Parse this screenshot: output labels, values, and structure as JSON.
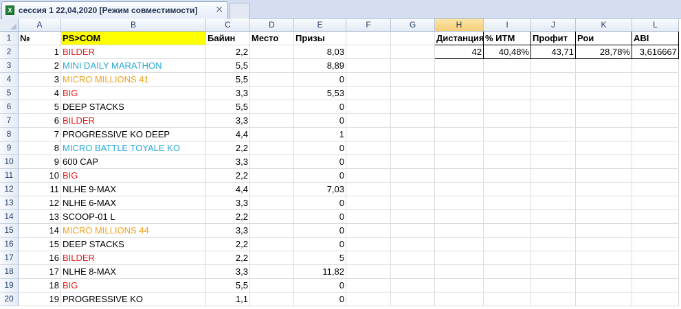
{
  "tab": {
    "icon": "excel-file-icon",
    "title": "сессия 1 22,04,2020  [Режим совместимости]",
    "close_glyph": "×"
  },
  "colors": {
    "red": "#e31f1f",
    "blue": "#24a8d8",
    "orange": "#f0a21a",
    "yellow": "#ffff00"
  },
  "columns": [
    "A",
    "B",
    "C",
    "D",
    "E",
    "F",
    "G",
    "H",
    "I",
    "J",
    "K",
    "L"
  ],
  "rows": [
    "1",
    "2",
    "3",
    "4",
    "5",
    "6",
    "7",
    "8",
    "9",
    "10",
    "11",
    "12",
    "13",
    "14",
    "15",
    "16",
    "17",
    "18",
    "19",
    "20"
  ],
  "headers": {
    "num": "№",
    "name": "PS>COM",
    "buyin": "Байин",
    "place": "Место",
    "prize": "Призы"
  },
  "tournaments": [
    {
      "n": "1",
      "name": "BILDER",
      "color": "red",
      "buyin": "2,2",
      "prize": "8,03"
    },
    {
      "n": "2",
      "name": "MINI DAILY MARATHON",
      "color": "blue",
      "buyin": "5,5",
      "prize": "8,89"
    },
    {
      "n": "3",
      "name": "MICRO MILLIONS 41",
      "color": "orange",
      "buyin": "5,5",
      "prize": "0"
    },
    {
      "n": "4",
      "name": "BIG",
      "color": "red",
      "buyin": "3,3",
      "prize": "5,53"
    },
    {
      "n": "5",
      "name": "DEEP STACKS",
      "color": "black",
      "buyin": "5,5",
      "prize": "0"
    },
    {
      "n": "6",
      "name": "BILDER",
      "color": "red",
      "buyin": "3,3",
      "prize": "0"
    },
    {
      "n": "7",
      "name": "PROGRESSIVE KO DEEP",
      "color": "black",
      "buyin": "4,4",
      "prize": "1"
    },
    {
      "n": "8",
      "name": "MICRO BATTLE TOYALE KO",
      "color": "blue",
      "buyin": "2,2",
      "prize": "0"
    },
    {
      "n": "9",
      "name": "600 CAP",
      "color": "black",
      "buyin": "3,3",
      "prize": "0"
    },
    {
      "n": "10",
      "name": "BIG",
      "color": "red",
      "buyin": "2,2",
      "prize": "0"
    },
    {
      "n": "11",
      "name": "NLHE 9-MAX",
      "color": "black",
      "buyin": "4,4",
      "prize": "7,03"
    },
    {
      "n": "12",
      "name": "NLHE 6-MAX",
      "color": "black",
      "buyin": "3,3",
      "prize": "0"
    },
    {
      "n": "13",
      "name": "SCOOP-01 L",
      "color": "black",
      "buyin": "2,2",
      "prize": "0"
    },
    {
      "n": "14",
      "name": "MICRO MILLIONS 44",
      "color": "orange",
      "buyin": "3,3",
      "prize": "0"
    },
    {
      "n": "15",
      "name": "DEEP STACKS",
      "color": "black",
      "buyin": "2,2",
      "prize": "0"
    },
    {
      "n": "16",
      "name": "BILDER",
      "color": "red",
      "buyin": "2,2",
      "prize": "5"
    },
    {
      "n": "17",
      "name": "NLHE 8-MAX",
      "color": "black",
      "buyin": "3,3",
      "prize": "11,82"
    },
    {
      "n": "18",
      "name": "BIG",
      "color": "red",
      "buyin": "5,5",
      "prize": "0"
    },
    {
      "n": "19",
      "name": "PROGRESSIVE KO",
      "color": "black",
      "buyin": "1,1",
      "prize": "0"
    }
  ],
  "stats": {
    "headers": [
      "Дистанция",
      "% ИТМ",
      "Профит",
      "Рои",
      "ABI"
    ],
    "values": [
      "42",
      "40,48%",
      "43,71",
      "28,78%",
      "3,616667"
    ]
  }
}
